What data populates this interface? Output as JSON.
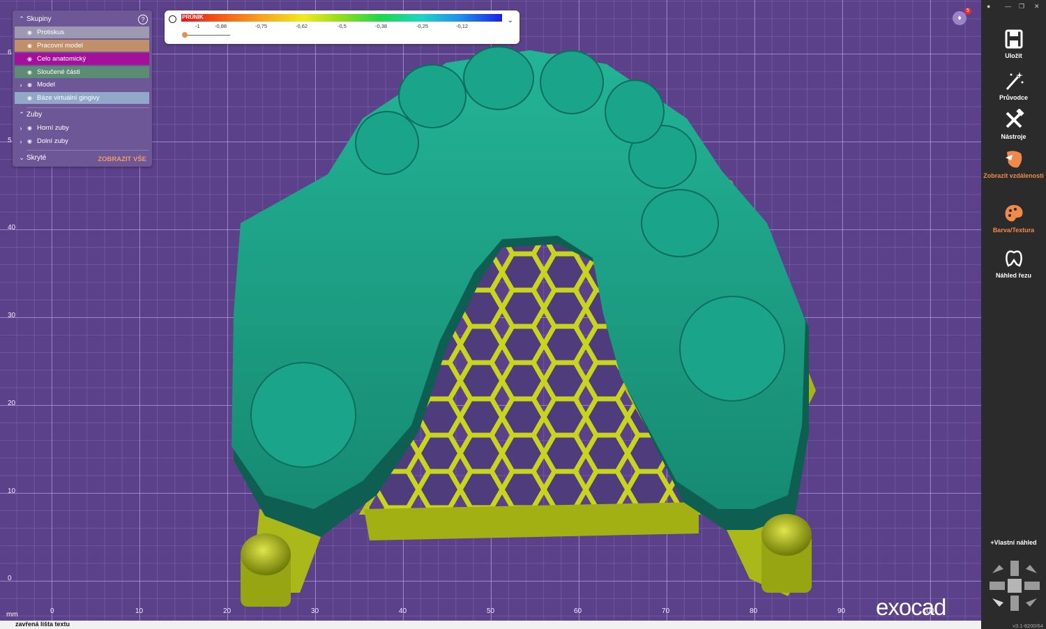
{
  "groups_panel": {
    "header": "Skupiny",
    "rows": [
      {
        "label": "Protiskus",
        "color": "#9c9ab2",
        "expandable": false,
        "eye": "hidden"
      },
      {
        "label": "Pracovní model",
        "color": "#c19069",
        "expandable": false,
        "eye": "hidden"
      },
      {
        "label": "Celo anatomický",
        "color": "#a3119a",
        "expandable": false,
        "eye": "hidden"
      },
      {
        "label": "Sloučené části",
        "color": "#5c8c74",
        "expandable": false,
        "eye": "hidden"
      },
      {
        "label": "Model",
        "color": "",
        "expandable": true,
        "eye": "visible"
      },
      {
        "label": "Báze virtuální gingivy",
        "color": "#91a8c8",
        "expandable": false,
        "eye": "hidden"
      }
    ],
    "teeth_header": "Zuby",
    "teeth_rows": [
      {
        "label": "Horní zuby",
        "eye": "visible"
      },
      {
        "label": "Dolní zuby",
        "eye": "hidden"
      }
    ],
    "hidden_header": "Skryté",
    "show_all": "ZOBRAZIT VŠE"
  },
  "colormap": {
    "title": "PRŮNIK",
    "ticks": [
      "-1",
      "-0,88",
      "-0,75",
      "-0,62",
      "-0,5",
      "-0,38",
      "-0,25",
      "-0,12"
    ]
  },
  "notifications": {
    "count": "5"
  },
  "axes": {
    "x_ticks": [
      "0",
      "10",
      "20",
      "30",
      "40",
      "50",
      "60",
      "70",
      "80",
      "90",
      "100"
    ],
    "y_ticks": [
      "6",
      "5",
      "40",
      "30",
      "20",
      "10",
      "0"
    ],
    "unit": "mm"
  },
  "status_bar": {
    "text": "zavřená lišta textu"
  },
  "logo": "exocad",
  "toolbar": {
    "items": [
      {
        "label": "Uložit",
        "icon": "save-icon"
      },
      {
        "label": "Průvodce",
        "icon": "wizard-wand-icon"
      },
      {
        "label": "Nástroje",
        "icon": "tools-icon"
      },
      {
        "label": "Zobrazit vzdálenosti",
        "icon": "distance-tooth-icon",
        "active": true
      },
      {
        "label": "Barva/Textura",
        "icon": "palette-icon",
        "active": true
      },
      {
        "label": "Náhled řezu",
        "icon": "section-view-icon"
      }
    ],
    "custom_view": "+Vlastní náhled",
    "version": "v3.1-8200/64"
  },
  "colors": {
    "model": "#1fa58c",
    "base": "#b8c81c",
    "background": "#5b4189"
  }
}
